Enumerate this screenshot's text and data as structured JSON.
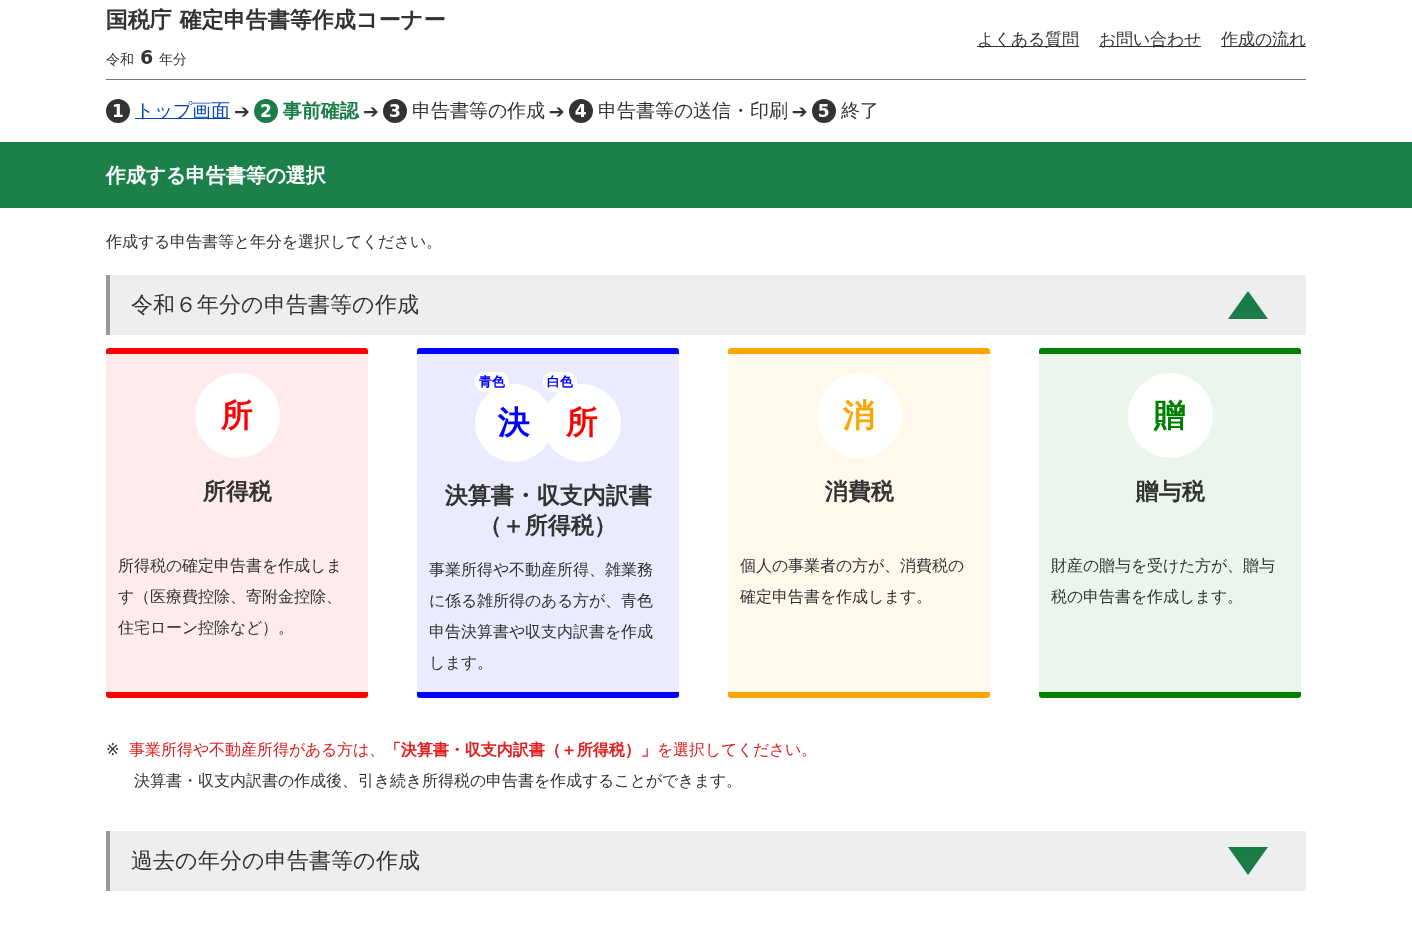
{
  "header": {
    "title": "国税庁 確定申告書等作成コーナー",
    "era": "令和",
    "year": "6",
    "year_suffix": "年分",
    "links": [
      "よくある質問",
      "お問い合わせ",
      "作成の流れ"
    ]
  },
  "steps": [
    {
      "number": "1",
      "label": "トップ画面",
      "kind": "link"
    },
    {
      "number": "2",
      "label": "事前確認",
      "kind": "current"
    },
    {
      "number": "3",
      "label": "申告書等の作成",
      "kind": "plain"
    },
    {
      "number": "4",
      "label": "申告書等の送信・印刷",
      "kind": "plain"
    },
    {
      "number": "5",
      "label": "終了",
      "kind": "plain"
    }
  ],
  "step_arrow": "➔",
  "banner": {
    "title": "作成する申告書等の選択"
  },
  "intro": "作成する申告書等と年分を選択してください。",
  "current_section": {
    "title": "令和６年分の申告書等の作成",
    "expanded": true
  },
  "cards": [
    {
      "color": "#ff0000",
      "icons": [
        {
          "char": "所",
          "color": "#ff0000"
        }
      ],
      "title_lines": [
        "所得税"
      ],
      "description": "所得税の確定申告書を作成します（医療費控除、寄附金控除、住宅ローン控除など）。"
    },
    {
      "color": "#0000ff",
      "icons": [
        {
          "char": "決",
          "color": "#0000ff",
          "tag": "青色"
        },
        {
          "char": "所",
          "color": "#ff0000",
          "tag": "白色"
        }
      ],
      "title_lines": [
        "決算書・収支内訳書",
        "（＋所得税）"
      ],
      "description": "事業所得や不動産所得、雑業務に係る雑所得のある方が、青色申告決算書や収支内訳書を作成します。"
    },
    {
      "color": "#ffa500",
      "icons": [
        {
          "char": "消",
          "color": "#ffa500"
        }
      ],
      "title_lines": [
        "消費税"
      ],
      "description": "個人の事業者の方が、消費税の確定申告書を作成します。"
    },
    {
      "color": "#008000",
      "icons": [
        {
          "char": "贈",
          "color": "#008000"
        }
      ],
      "title_lines": [
        "贈与税"
      ],
      "description": "財産の贈与を受けた方が、贈与税の申告書を作成します。"
    }
  ],
  "note": {
    "mark": "※",
    "text": "事業所得や不動産所得がある方は、**「決算書・収支内訳書（＋所得税）」**を選択してください。",
    "subtext": "決算書・収支内訳書の作成後、引き続き所得税の申告書を作成することができます。"
  },
  "past_section": {
    "title": "過去の年分の申告書等の作成",
    "expanded": false
  }
}
